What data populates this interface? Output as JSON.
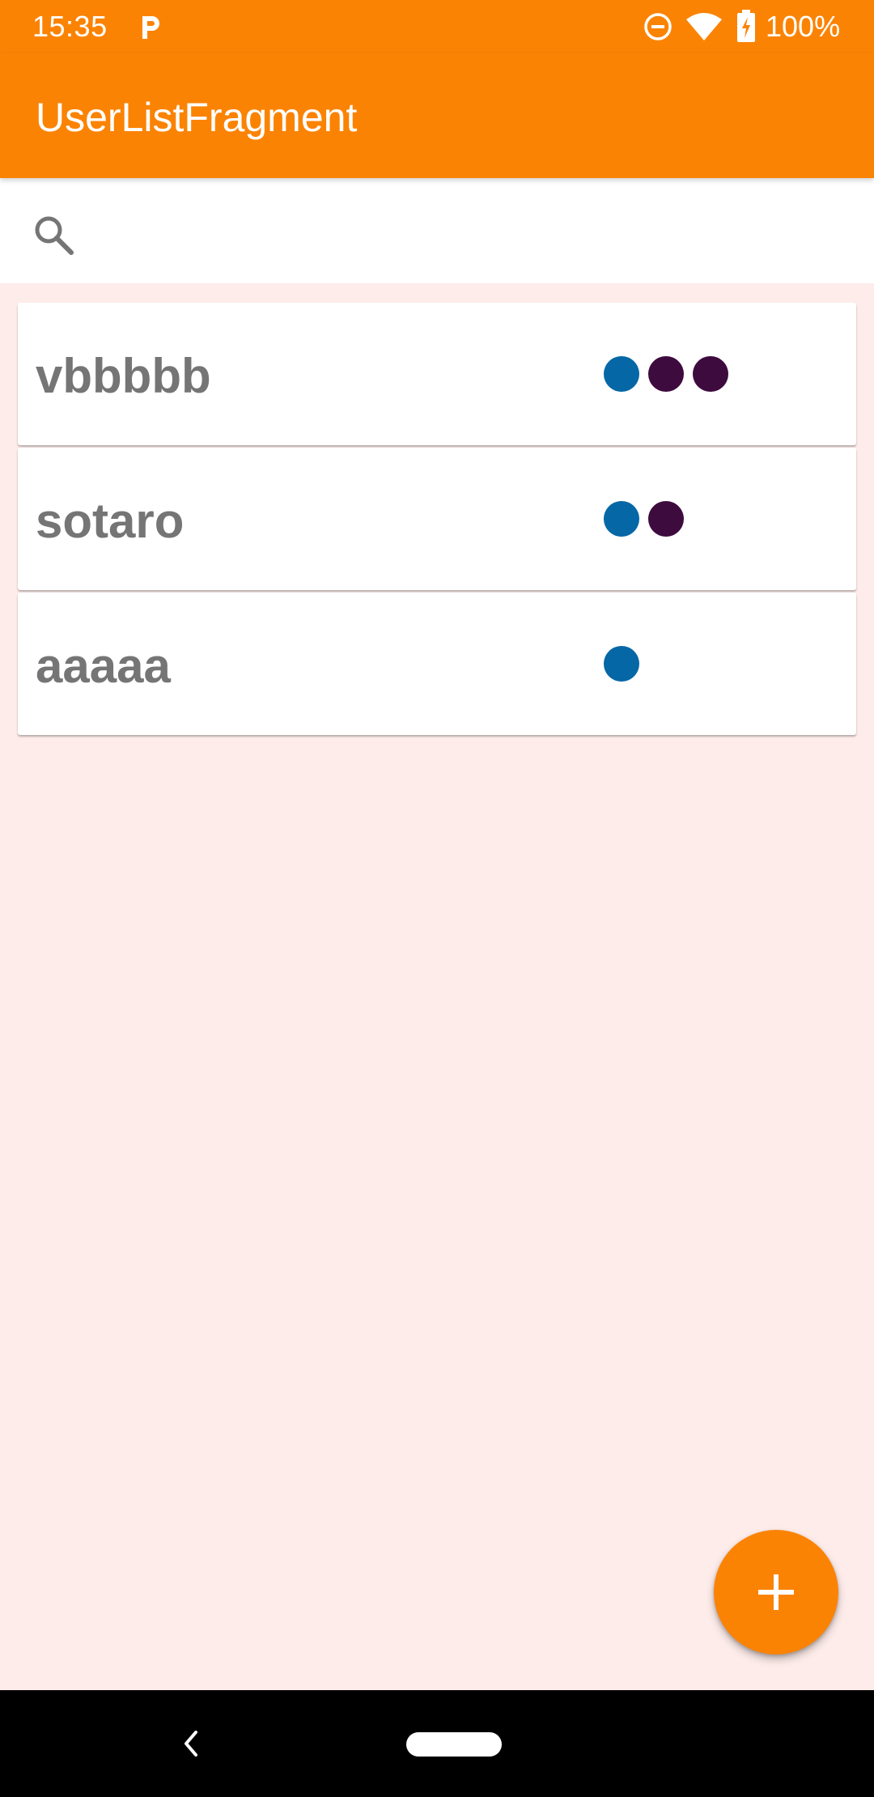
{
  "status_bar": {
    "time": "15:35",
    "battery": "100%"
  },
  "app_bar": {
    "title": "UserListFragment"
  },
  "search": {
    "placeholder": "",
    "value": ""
  },
  "users": [
    {
      "name": "vbbbbb",
      "dots": [
        "#0567a5",
        "#3e0b3e",
        "#3e0b3e"
      ]
    },
    {
      "name": "sotaro",
      "dots": [
        "#0567a5",
        "#3e0b3e"
      ]
    },
    {
      "name": "aaaaa",
      "dots": [
        "#0567a5"
      ]
    }
  ],
  "colors": {
    "primary": "#fb8304",
    "background": "#fdecea",
    "dot_blue": "#0567a5",
    "dot_purple": "#3e0b3e"
  },
  "icons": {
    "status": [
      "parking-icon",
      "do-not-disturb-icon",
      "wifi-icon",
      "battery-charging-icon"
    ],
    "search": "search-icon",
    "fab": "add-icon",
    "nav": [
      "back-icon",
      "home-pill"
    ]
  }
}
